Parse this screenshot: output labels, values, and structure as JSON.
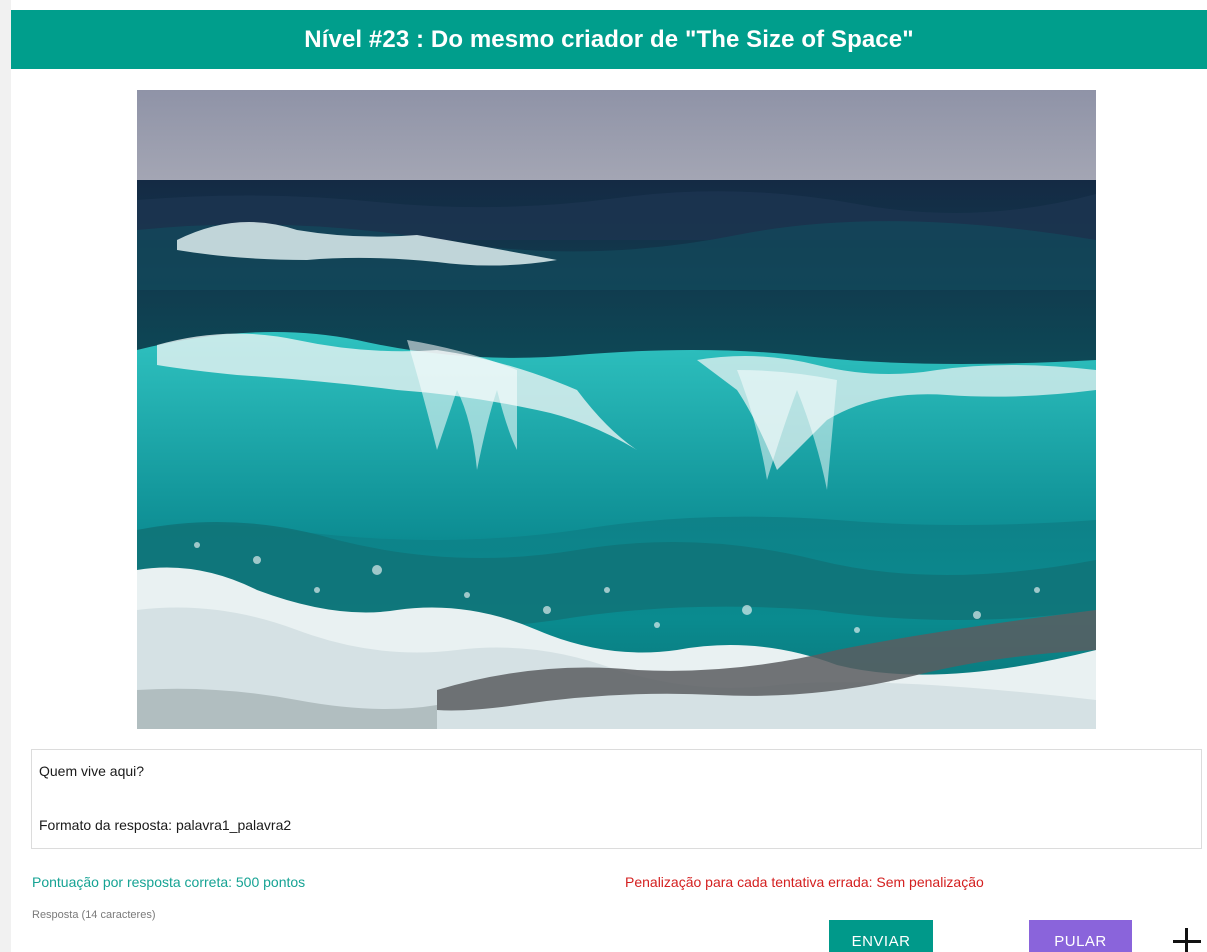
{
  "header": {
    "title": "Nível #23 : Do mesmo criador de \"The Size of Space\""
  },
  "puzzle": {
    "image_subject": "ocean waves"
  },
  "question": {
    "line1": "Quem vive aqui?",
    "line2": "Formato da resposta: palavra1_palavra2"
  },
  "scoring": {
    "points_text": "Pontuação por resposta correta: 500 pontos",
    "penalty_text": "Penalização para cada tentativa errada: Sem penalização"
  },
  "answer": {
    "label": "Resposta (14 caracteres)"
  },
  "buttons": {
    "send_label": "ENVIAR",
    "skip_label": "PULAR"
  },
  "colors": {
    "header_bg": "#009e8c",
    "send_bg": "#00998a",
    "skip_bg": "#8a64db",
    "score_text": "#16a394",
    "penalty_text": "#d42020"
  },
  "icons": {
    "add": "plus-icon"
  }
}
